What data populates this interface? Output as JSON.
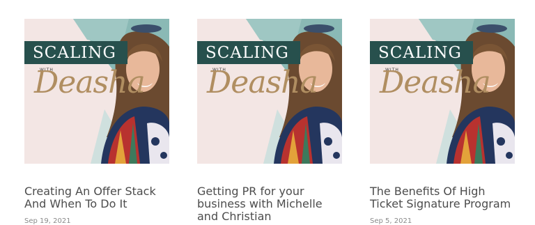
{
  "thumbnail": {
    "brand_title": "SCALING",
    "brand_with": "WITH",
    "brand_name": "Deasha"
  },
  "posts": [
    {
      "title": "Creating An Offer Stack And When To Do It",
      "date": "Sep 19, 2021"
    },
    {
      "title": "Getting PR for your business with Michelle and Christian",
      "date": ""
    },
    {
      "title": "The Benefits Of High Ticket Signature Program",
      "date": "Sep 5, 2021"
    }
  ],
  "colors": {
    "brand_band": "#27504d",
    "teal_shape": "#8ab9b5",
    "pink_background": "#f3e6e4",
    "script_gold": "#b08e61",
    "title_text": "#4c4c4c",
    "date_text": "#8a8a8a"
  }
}
